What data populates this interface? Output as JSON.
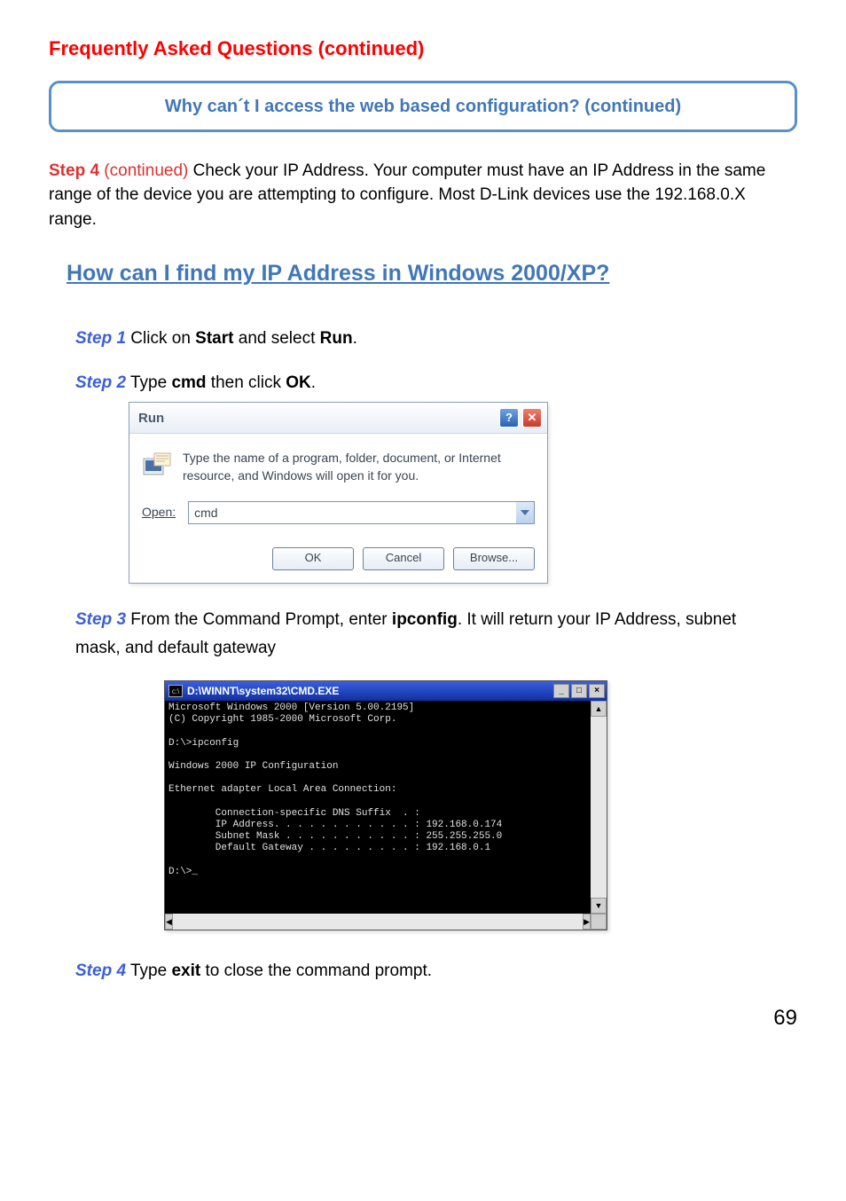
{
  "title": "Frequently Asked Questions (continued)",
  "callout": "Why can´t I access the web based configuration? (continued)",
  "intro": {
    "step_label": "Step 4",
    "continued": " (continued)",
    "text": " Check your IP Address. Your computer must have an IP Address in the same range of the device you are attempting to configure. Most D-Link devices use the 192.168.0.X range."
  },
  "faq_link": "How can I find my IP Address in Windows 2000/XP?",
  "step1": {
    "label": "Step 1",
    "pre": " Click on ",
    "bold1": "Start",
    "mid": " and select ",
    "bold2": "Run",
    "post": "."
  },
  "step2": {
    "label": "Step 2",
    "pre": " Type ",
    "bold1": "cmd",
    "mid": " then click ",
    "bold2": "OK",
    "post": "."
  },
  "run_dialog": {
    "title": "Run",
    "help_glyph": "?",
    "close_glyph": "✕",
    "description": "Type the name of a program, folder, document, or Internet resource, and Windows will open it for you.",
    "open_label": "Open:",
    "open_value": "cmd",
    "chevron": "⌄",
    "ok": "OK",
    "cancel": "Cancel",
    "browse": "Browse..."
  },
  "step3": {
    "label": "Step 3",
    "pre": " From the Command Prompt, enter ",
    "bold1": "ipconfig",
    "post": ". It will return your IP Address, subnet mask, and default gateway"
  },
  "cmd": {
    "icon_glyph": "c:\\",
    "title": "D:\\WINNT\\system32\\CMD.EXE",
    "min": "_",
    "max": "□",
    "close": "×",
    "up": "▲",
    "down": "▼",
    "left": "◀",
    "right": "▶",
    "output": "Microsoft Windows 2000 [Version 5.00.2195]\n(C) Copyright 1985-2000 Microsoft Corp.\n\nD:\\>ipconfig\n\nWindows 2000 IP Configuration\n\nEthernet adapter Local Area Connection:\n\n        Connection-specific DNS Suffix  . :\n        IP Address. . . . . . . . . . . . : 192.168.0.174\n        Subnet Mask . . . . . . . . . . . : 255.255.255.0\n        Default Gateway . . . . . . . . . : 192.168.0.1\n\nD:\\>_"
  },
  "step4b": {
    "label": "Step 4",
    "pre": " Type ",
    "bold1": "exit",
    "post": " to close the command prompt."
  },
  "page_number": "69"
}
